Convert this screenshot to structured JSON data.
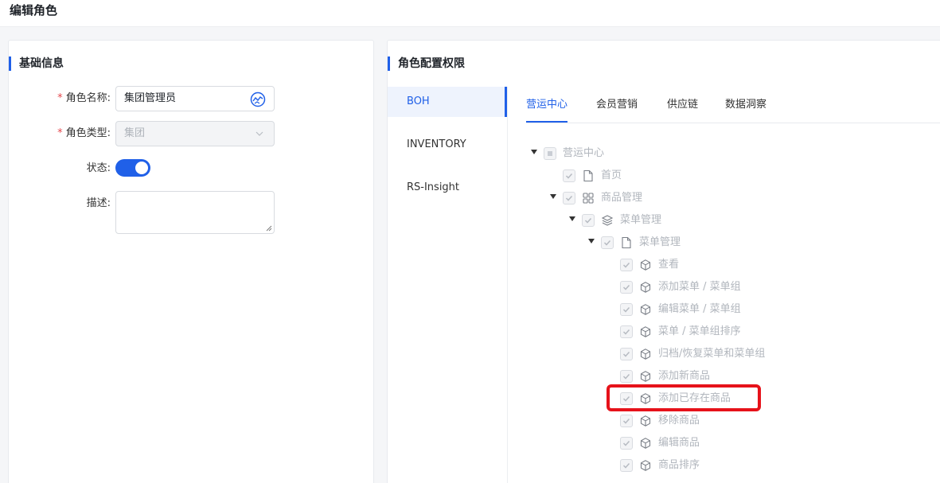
{
  "page": {
    "title": "编辑角色"
  },
  "basic": {
    "title": "基础信息",
    "role_name_label": "角色名称:",
    "role_name_value": "集团管理员",
    "role_type_label": "角色类型:",
    "role_type_value": "集团",
    "status_label": "状态:",
    "status_on": true,
    "desc_label": "描述:",
    "required_mark": "*"
  },
  "perm": {
    "title": "角色配置权限",
    "side_items": [
      "BOH",
      "INVENTORY",
      "RS-Insight"
    ],
    "tabs": [
      "营运中心",
      "会员营销",
      "供应链",
      "数据洞察"
    ],
    "active_tab": "营运中心",
    "tree": [
      {
        "label": "营运中心",
        "icon": "none",
        "check": "indeterminate",
        "caret": true
      },
      {
        "label": "首页",
        "icon": "file-icon",
        "check": "checked",
        "caret": false
      },
      {
        "label": "商品管理",
        "icon": "grid-icon",
        "check": "checked",
        "caret": true
      },
      {
        "label": "菜单管理",
        "icon": "layers-icon",
        "check": "checked",
        "caret": true
      },
      {
        "label": "菜单管理",
        "icon": "file-icon",
        "check": "checked",
        "caret": true
      },
      {
        "label": "查看",
        "icon": "cube-icon",
        "check": "checked",
        "caret": false
      },
      {
        "label": "添加菜单 / 菜单组",
        "icon": "cube-icon",
        "check": "checked",
        "caret": false
      },
      {
        "label": "编辑菜单 / 菜单组",
        "icon": "cube-icon",
        "check": "checked",
        "caret": false
      },
      {
        "label": "菜单 / 菜单组排序",
        "icon": "cube-icon",
        "check": "checked",
        "caret": false
      },
      {
        "label": "归档/恢复菜单和菜单组",
        "icon": "cube-icon",
        "check": "checked",
        "caret": false
      },
      {
        "label": "添加新商品",
        "icon": "cube-icon",
        "check": "checked",
        "caret": false
      },
      {
        "label": "添加已存在商品",
        "icon": "cube-icon",
        "check": "checked",
        "caret": false
      },
      {
        "label": "移除商品",
        "icon": "cube-icon",
        "check": "checked",
        "caret": false
      },
      {
        "label": "编辑商品",
        "icon": "cube-icon",
        "check": "checked",
        "caret": false
      },
      {
        "label": "商品排序",
        "icon": "cube-icon",
        "check": "checked",
        "caret": false
      }
    ]
  },
  "colors": {
    "accent": "#2060e8",
    "highlight": "#e6121a",
    "required": "#e5484d"
  }
}
